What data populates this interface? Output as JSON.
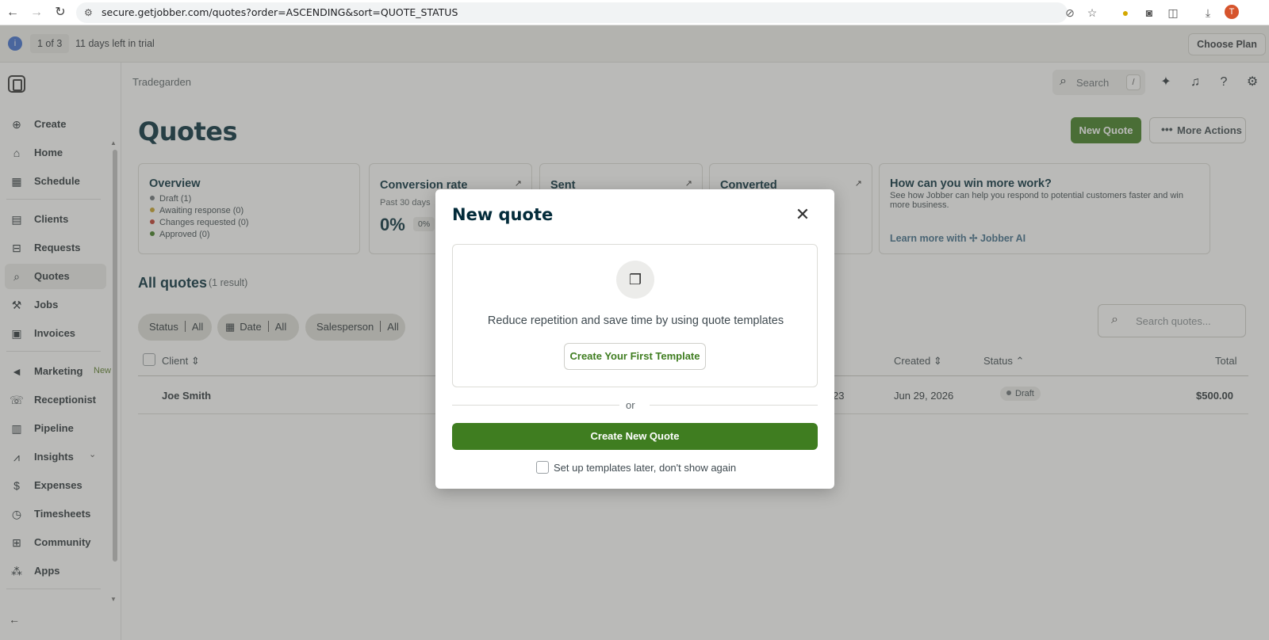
{
  "browser": {
    "url": "secure.getjobber.com/quotes?order=ASCENDING&sort=QUOTE_STATUS",
    "profile_initial": "T"
  },
  "trial": {
    "pager": "1 of 3",
    "text": "11 days left in trial",
    "choose_plan": "Choose Plan"
  },
  "sidebar": {
    "items": [
      {
        "label": "Create",
        "icon": "plus-circle-icon"
      },
      {
        "label": "Home",
        "icon": "home-icon"
      },
      {
        "label": "Schedule",
        "icon": "calendar-icon"
      },
      {
        "label": "Clients",
        "icon": "clients-icon"
      },
      {
        "label": "Requests",
        "icon": "requests-icon"
      },
      {
        "label": "Quotes",
        "icon": "quotes-icon"
      },
      {
        "label": "Jobs",
        "icon": "hammer-icon"
      },
      {
        "label": "Invoices",
        "icon": "invoice-icon"
      },
      {
        "label": "Marketing",
        "icon": "megaphone-icon"
      },
      {
        "label": "Receptionist",
        "icon": "receptionist-icon"
      },
      {
        "label": "Pipeline",
        "icon": "pipeline-icon"
      },
      {
        "label": "Insights",
        "icon": "chart-icon"
      },
      {
        "label": "Expenses",
        "icon": "expenses-icon"
      },
      {
        "label": "Timesheets",
        "icon": "clock-icon"
      },
      {
        "label": "Community",
        "icon": "community-icon"
      },
      {
        "label": "Apps",
        "icon": "apps-icon"
      }
    ],
    "marketing_badge": "New",
    "active": "Quotes"
  },
  "header": {
    "breadcrumb": "Tradegarden",
    "search_label": "Search",
    "search_shortcut": "/"
  },
  "page": {
    "title": "Quotes",
    "new_quote": "New Quote",
    "more_actions": "More Actions"
  },
  "overview": {
    "title": "Overview",
    "legend": [
      {
        "label": "Draft (1)",
        "color": "#6b7377"
      },
      {
        "label": "Awaiting response (0)",
        "color": "#c9a227"
      },
      {
        "label": "Changes requested (0)",
        "color": "#c0392b"
      },
      {
        "label": "Approved (0)",
        "color": "#3f7d20"
      }
    ]
  },
  "conversion": {
    "title": "Conversion rate",
    "subtitle": "Past 30 days",
    "value": "0%",
    "badge": "0%"
  },
  "sent": {
    "title": "Sent"
  },
  "converted": {
    "title": "Converted"
  },
  "win": {
    "title": "How can you win more work?",
    "description": "See how Jobber can help you respond to potential customers faster and win more business.",
    "link": "Learn more with ✢ Jobber AI"
  },
  "list": {
    "title": "All quotes",
    "count": "(1 result)",
    "filters": [
      {
        "label": "Status",
        "value": "All"
      },
      {
        "label": "Date",
        "value": "All"
      },
      {
        "label": "Salesperson",
        "value": "All"
      }
    ],
    "search_placeholder": "Search quotes...",
    "columns": {
      "client": "Client",
      "created": "Created",
      "status": "Status",
      "total": "Total"
    },
    "rows": [
      {
        "client": "Joe Smith",
        "partial": "23",
        "created": "Jun 29, 2026",
        "status": "Draft",
        "total": "$500.00"
      }
    ]
  },
  "modal": {
    "title": "New quote",
    "template_text": "Reduce repetition and save time by using quote templates",
    "template_button": "Create Your First Template",
    "or": "or",
    "create_button": "Create New Quote",
    "later_label": "Set up templates later, don't show again"
  }
}
